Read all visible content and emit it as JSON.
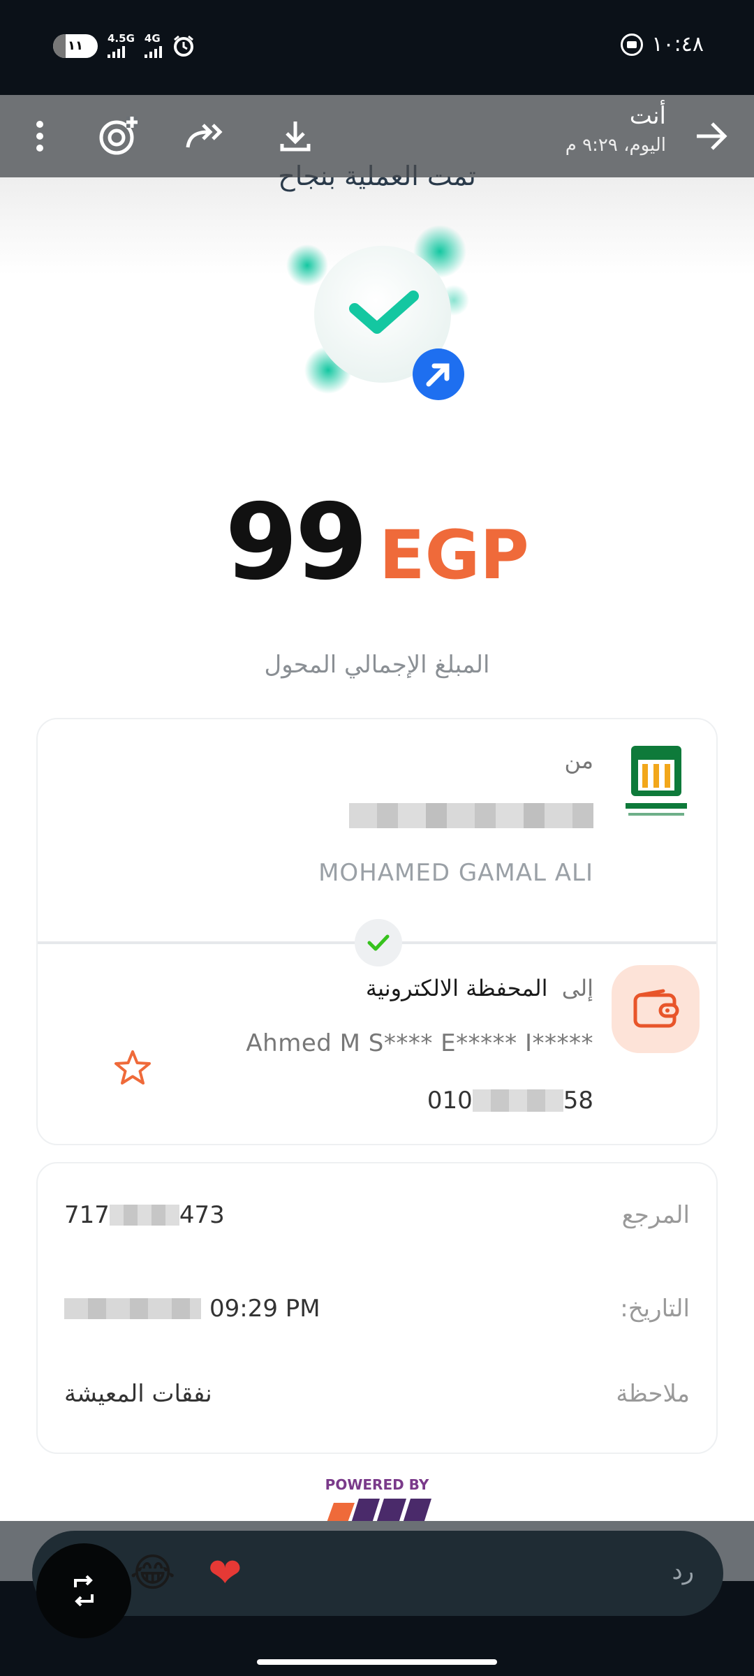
{
  "status_bar": {
    "battery": "١١",
    "signal1_label": "4.5G",
    "signal2_label": "4G",
    "time": "١٠:٤٨"
  },
  "viewer": {
    "sender_name": "أنت",
    "timestamp": "اليوم، ٩:٢٩ م"
  },
  "receipt": {
    "title": "تمت العملية بنجاح",
    "amount": "99",
    "currency": "EGP",
    "amount_label": "المبلغ الإجمالي المحول",
    "from": {
      "label": "من",
      "bank_logo_text": "البنك الأهلي المصري",
      "name": "MOHAMED GAMAL ALI"
    },
    "to": {
      "label": "إلى",
      "destination": "المحفظة الالكترونية",
      "name": "Ahmed M S**** E***** I*****",
      "phone_prefix": "010",
      "phone_suffix": "58"
    },
    "details": {
      "ref_label": "المرجع",
      "ref_prefix": "717",
      "ref_suffix": "473",
      "date_label": "التاريخ:",
      "time": "09:29 PM",
      "note_label": "ملاحظة",
      "note_value": "نفقات المعيشة"
    },
    "powered_by": "POWERED BY"
  },
  "reply": {
    "placeholder": "رد",
    "emoji_1": "😂",
    "emoji_2": "❤"
  },
  "colors": {
    "accent_orange": "#ef6a3a",
    "success_teal": "#1bc9a8",
    "blue_badge": "#1e6ff0"
  }
}
